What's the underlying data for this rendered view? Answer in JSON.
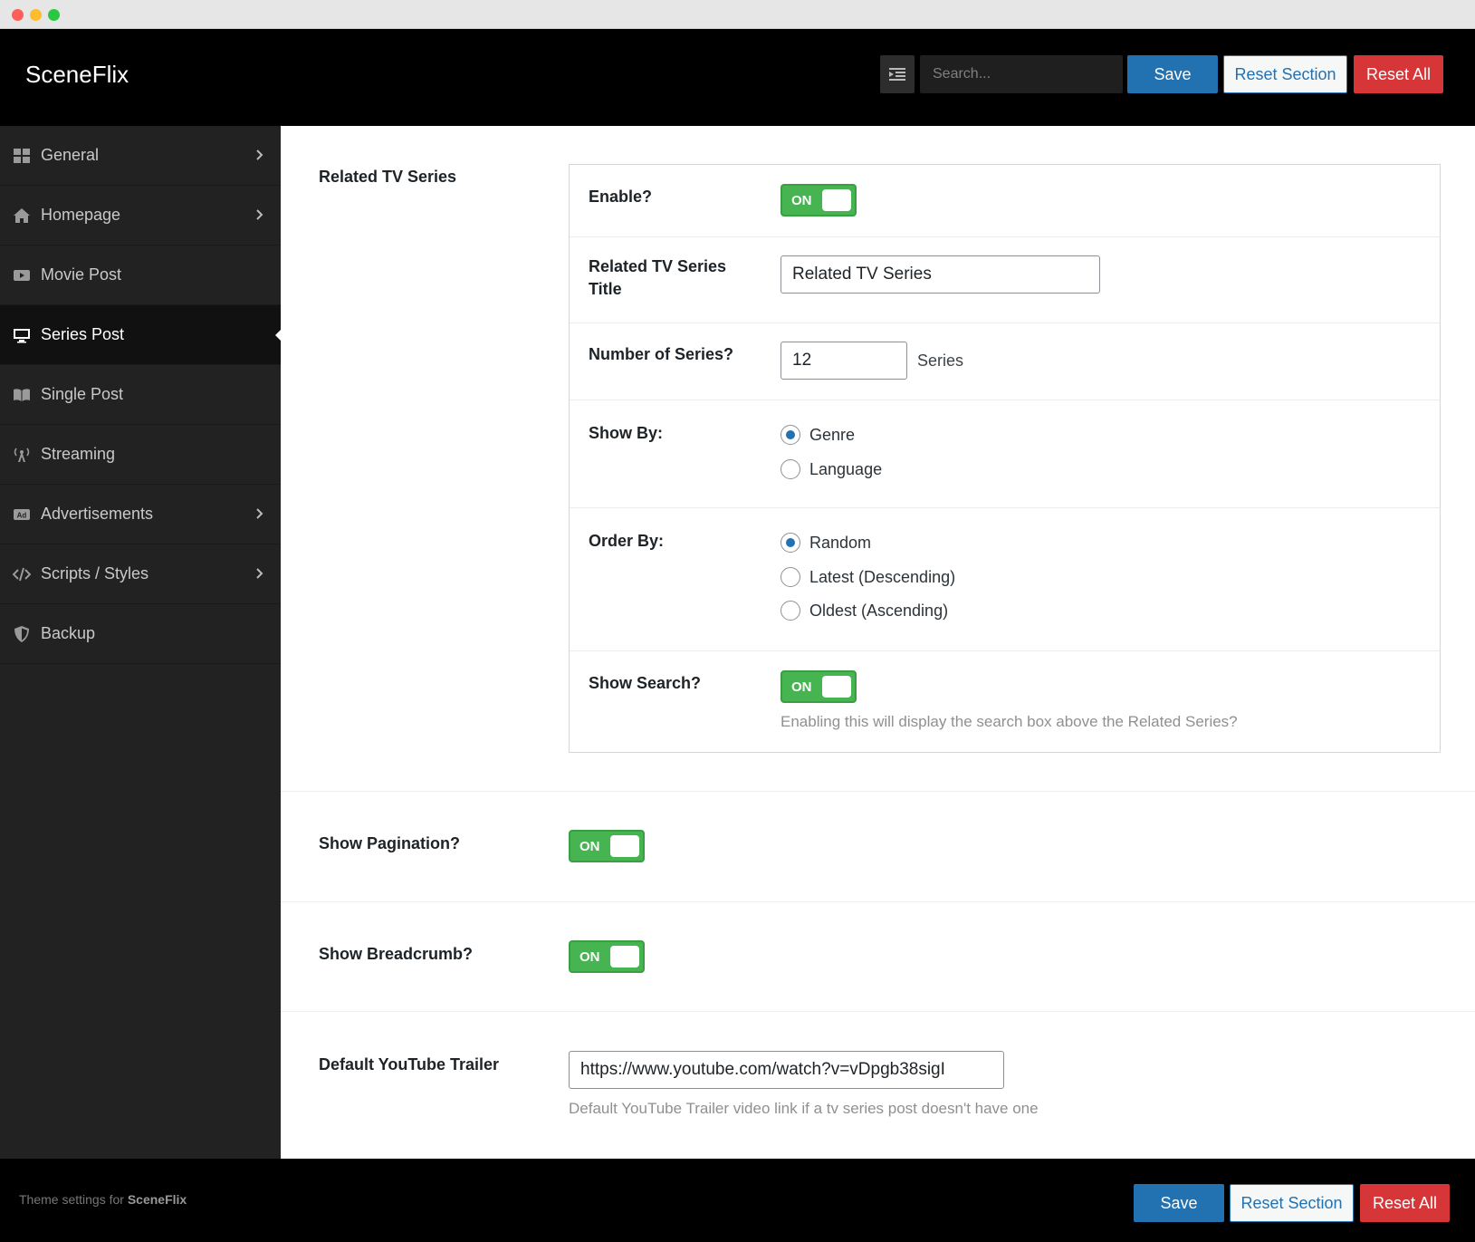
{
  "app": {
    "brand": "SceneFlix"
  },
  "header": {
    "search_placeholder": "Search...",
    "save_label": "Save",
    "reset_section_label": "Reset Section",
    "reset_all_label": "Reset All"
  },
  "sidebar": {
    "items": [
      {
        "label": "General",
        "icon": "grid-icon",
        "has_children": true,
        "active": false
      },
      {
        "label": "Homepage",
        "icon": "home-icon",
        "has_children": true,
        "active": false
      },
      {
        "label": "Movie Post",
        "icon": "video-icon",
        "has_children": false,
        "active": false
      },
      {
        "label": "Series Post",
        "icon": "monitor-icon",
        "has_children": false,
        "active": true
      },
      {
        "label": "Single Post",
        "icon": "book-icon",
        "has_children": false,
        "active": false
      },
      {
        "label": "Streaming",
        "icon": "broadcast-icon",
        "has_children": false,
        "active": false
      },
      {
        "label": "Advertisements",
        "icon": "ad-icon",
        "has_children": true,
        "active": false
      },
      {
        "label": "Scripts / Styles",
        "icon": "code-icon",
        "has_children": true,
        "active": false
      },
      {
        "label": "Backup",
        "icon": "shield-icon",
        "has_children": false,
        "active": false
      }
    ]
  },
  "main": {
    "related": {
      "label": "Related TV Series",
      "enable_label": "Enable?",
      "enable_state": "ON",
      "title_label": "Related TV Series Title",
      "title_value": "Related TV Series",
      "number_label": "Number of Series?",
      "number_value": "12",
      "number_suffix": "Series",
      "show_by_label": "Show By:",
      "show_by_options": [
        "Genre",
        "Language"
      ],
      "show_by_selected": "Genre",
      "order_by_label": "Order By:",
      "order_by_options": [
        "Random",
        "Latest (Descending)",
        "Oldest (Ascending)"
      ],
      "order_by_selected": "Random",
      "show_search_label": "Show Search?",
      "show_search_state": "ON",
      "show_search_hint": "Enabling this will display the search box above the Related Series?"
    },
    "pagination": {
      "label": "Show Pagination?",
      "state": "ON"
    },
    "breadcrumb": {
      "label": "Show Breadcrumb?",
      "state": "ON"
    },
    "trailer": {
      "label": "Default YouTube Trailer",
      "value": "https://www.youtube.com/watch?v=vDpgb38sigI",
      "hint": "Default YouTube Trailer video link if a tv series post doesn't have one"
    }
  },
  "footer": {
    "text_prefix": "Theme settings for",
    "text_brand": "SceneFlix",
    "save_label": "Save",
    "reset_section_label": "Reset Section",
    "reset_all_label": "Reset All"
  },
  "colors": {
    "accent": "#2271b1",
    "danger": "#d63638",
    "toggle_on": "#46b450",
    "sidebar_bg": "#222222",
    "header_bg": "#000000"
  }
}
